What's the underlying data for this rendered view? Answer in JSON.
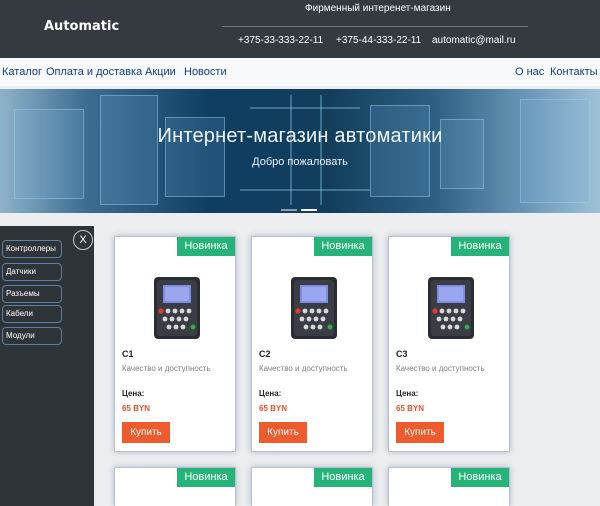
{
  "header": {
    "logo": "Automatic",
    "tagline": "Фирменный интеренет-магазин",
    "phone1": "+375-33-333-22-11",
    "phone2": "+375-44-333-22-11",
    "email": "automatic@mail.ru"
  },
  "nav": {
    "catalog": "Каталог",
    "delivery": "Оплата и доставка",
    "promos": "Акции",
    "news": "Новости",
    "about": "О нас",
    "contacts": "Контакты"
  },
  "hero": {
    "title": "Интернет-магазин автоматики",
    "subtitle": "Добро пожаловать"
  },
  "sidebar": {
    "close": "X",
    "items": [
      "Контроллеры",
      "Датчики",
      "Разъемы",
      "Кабели",
      "Модули"
    ]
  },
  "products": [
    {
      "badge": "Новинка",
      "name": "C1",
      "desc": "Качество и доступность",
      "price_label": "Цена:",
      "price": "65 BYN",
      "buy": "Купить"
    },
    {
      "badge": "Новинка",
      "name": "C2",
      "desc": "Качество и доступность",
      "price_label": "Цена:",
      "price": "65 BYN",
      "buy": "Купить"
    },
    {
      "badge": "Новинка",
      "name": "C3",
      "desc": "Качество и доступность",
      "price_label": "Цена:",
      "price": "65 BYN",
      "buy": "Купить"
    },
    {
      "badge": "Новинка"
    },
    {
      "badge": "Новинка"
    },
    {
      "badge": "Новинка"
    }
  ],
  "colors": {
    "header_bg": "#343a40",
    "badge": "#26b37a",
    "buy_button": "#ee5b2c",
    "price": "#e8502a",
    "nav_link": "#0d3b8a",
    "sidebar_bg": "#2f3438"
  }
}
